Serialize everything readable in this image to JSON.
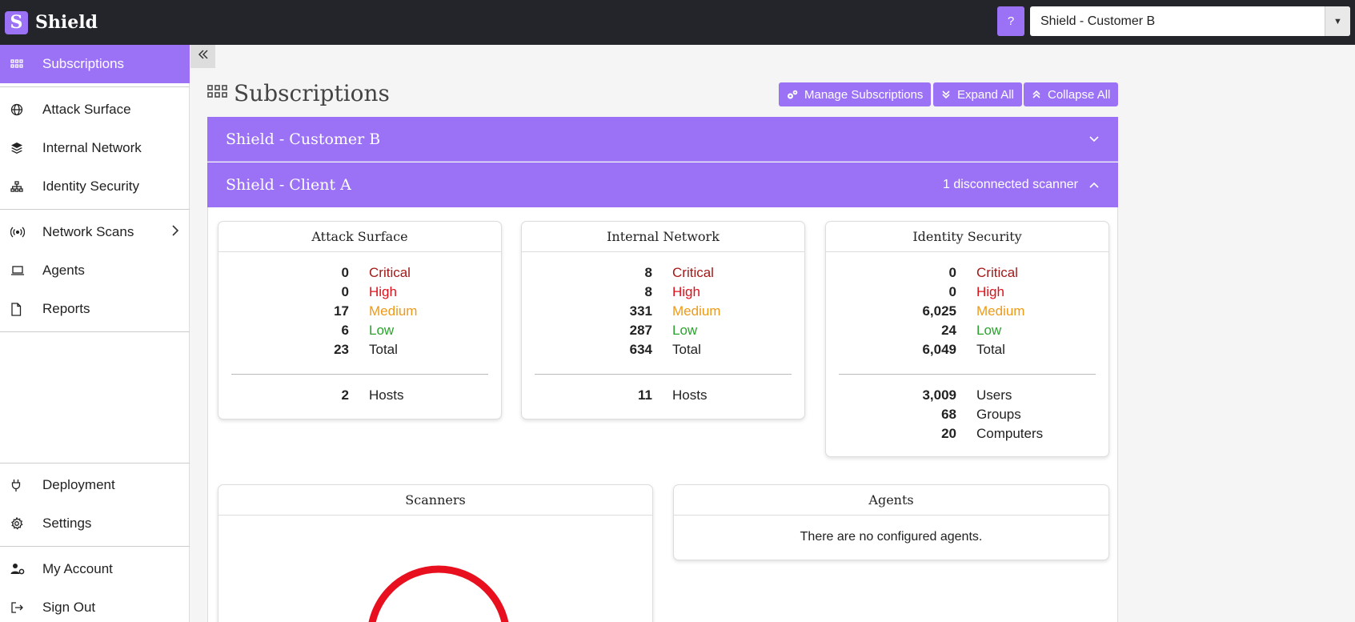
{
  "app": {
    "logo_letter": "S",
    "name": "Shield"
  },
  "topbar": {
    "help_label": "?",
    "tenant_selected": "Shield - Customer B"
  },
  "sidebar": {
    "items": [
      {
        "label": "Subscriptions",
        "icon": "grid-icon"
      },
      {
        "label": "Attack Surface",
        "icon": "globe-icon"
      },
      {
        "label": "Internal Network",
        "icon": "layers-icon"
      },
      {
        "label": "Identity Security",
        "icon": "sitemap-icon"
      },
      {
        "label": "Network Scans",
        "icon": "broadcast-icon"
      },
      {
        "label": "Agents",
        "icon": "laptop-icon"
      },
      {
        "label": "Reports",
        "icon": "file-icon"
      },
      {
        "label": "Deployment",
        "icon": "plug-icon"
      },
      {
        "label": "Settings",
        "icon": "gear-icon"
      },
      {
        "label": "My Account",
        "icon": "user-gear-icon"
      },
      {
        "label": "Sign Out",
        "icon": "sign-out-icon"
      }
    ]
  },
  "page": {
    "title": "Subscriptions",
    "buttons": {
      "manage": "Manage Subscriptions",
      "expand": "Expand All",
      "collapse": "Collapse All"
    }
  },
  "subscriptions": [
    {
      "name": "Shield - Customer B",
      "status": "",
      "expanded": false
    },
    {
      "name": "Shield - Client A",
      "status": "1 disconnected scanner",
      "expanded": true
    }
  ],
  "cards": {
    "attack_surface": {
      "title": "Attack Surface",
      "stats": [
        {
          "value": "0",
          "label": "Critical"
        },
        {
          "value": "0",
          "label": "High"
        },
        {
          "value": "17",
          "label": "Medium"
        },
        {
          "value": "6",
          "label": "Low"
        },
        {
          "value": "23",
          "label": "Total"
        }
      ],
      "extra": [
        {
          "value": "2",
          "label": "Hosts"
        }
      ]
    },
    "internal_network": {
      "title": "Internal Network",
      "stats": [
        {
          "value": "8",
          "label": "Critical"
        },
        {
          "value": "8",
          "label": "High"
        },
        {
          "value": "331",
          "label": "Medium"
        },
        {
          "value": "287",
          "label": "Low"
        },
        {
          "value": "634",
          "label": "Total"
        }
      ],
      "extra": [
        {
          "value": "11",
          "label": "Hosts"
        }
      ]
    },
    "identity_security": {
      "title": "Identity Security",
      "stats": [
        {
          "value": "0",
          "label": "Critical"
        },
        {
          "value": "0",
          "label": "High"
        },
        {
          "value": "6,025",
          "label": "Medium"
        },
        {
          "value": "24",
          "label": "Low"
        },
        {
          "value": "6,049",
          "label": "Total"
        }
      ],
      "extra": [
        {
          "value": "3,009",
          "label": "Users"
        },
        {
          "value": "68",
          "label": "Groups"
        },
        {
          "value": "20",
          "label": "Computers"
        }
      ]
    },
    "scanners": {
      "title": "Scanners",
      "gauge_color": "#e8101e"
    },
    "agents": {
      "title": "Agents",
      "empty_message": "There are no configured agents."
    }
  },
  "colors": {
    "accent": "#9b72f5",
    "critical": "#a31919",
    "high": "#e0101a",
    "medium": "#ee9a17",
    "low": "#2aa32c",
    "topbar": "#23252b"
  }
}
